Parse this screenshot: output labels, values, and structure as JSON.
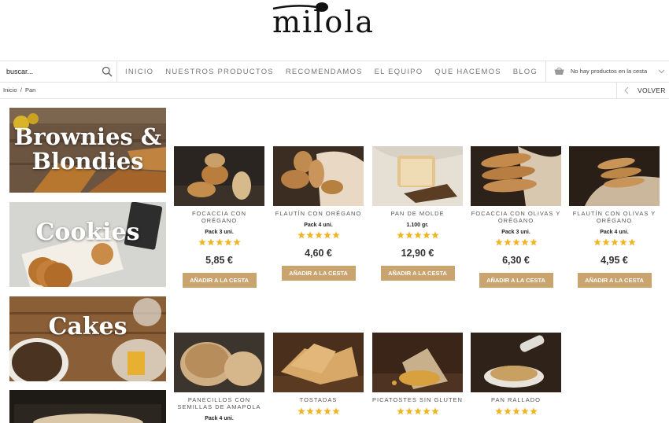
{
  "brand": {
    "logo_text": "milola"
  },
  "search": {
    "placeholder": "buscar..."
  },
  "nav": {
    "items": [
      "INICIO",
      "NUESTROS PRODUCTOS",
      "RECOMENDAMOS",
      "EL EQUIPO",
      "QUE HACEMOS",
      "BLOG"
    ]
  },
  "cart": {
    "text": "No hay productos en la cesta"
  },
  "breadcrumb": {
    "home": "Inicio",
    "separator": "/",
    "current": "Pan"
  },
  "back": {
    "label": "VOLVER"
  },
  "categories": [
    {
      "title_line1": "Brownies &",
      "title_line2": "Blondies"
    },
    {
      "title_line1": "Cookies"
    },
    {
      "title_line1": "Cakes"
    }
  ],
  "colors": {
    "accent": "#c9a46f",
    "star": "#f0b323"
  },
  "add_to_cart_label": "AÑADIR A LA CESTA",
  "products": [
    {
      "name": "FOCACCIA CON ORÉGANO",
      "note": "Pack 3 uni.",
      "rating": 5,
      "price": "5,85 €"
    },
    {
      "name": "FLAUTÍN CON ORÉGANO",
      "note": "Pack 4 uni.",
      "rating": 5,
      "price": "4,60 €"
    },
    {
      "name": "PAN DE MOLDE",
      "note": "1.100 gr.",
      "rating": 5,
      "price": "12,90 €"
    },
    {
      "name": "FOCACCIA CON OLIVAS Y ORÉGANO",
      "note": "Pack 3 uni.",
      "rating": 5,
      "price": "6,30 €"
    },
    {
      "name": "FLAUTÍN CON OLIVAS Y ORÉGANO",
      "note": "Pack 4 uni.",
      "rating": 5,
      "price": "4,95 €"
    },
    {
      "name": "PANECILLOS CON SEMILLAS DE AMAPOLA",
      "note": "Pack 4 uni.",
      "rating": 5
    },
    {
      "name": "TOSTADAS",
      "rating": 5
    },
    {
      "name": "PICATOSTES SIN GLUTEN",
      "rating": 5
    },
    {
      "name": "PAN RALLADO",
      "rating": 5
    }
  ]
}
